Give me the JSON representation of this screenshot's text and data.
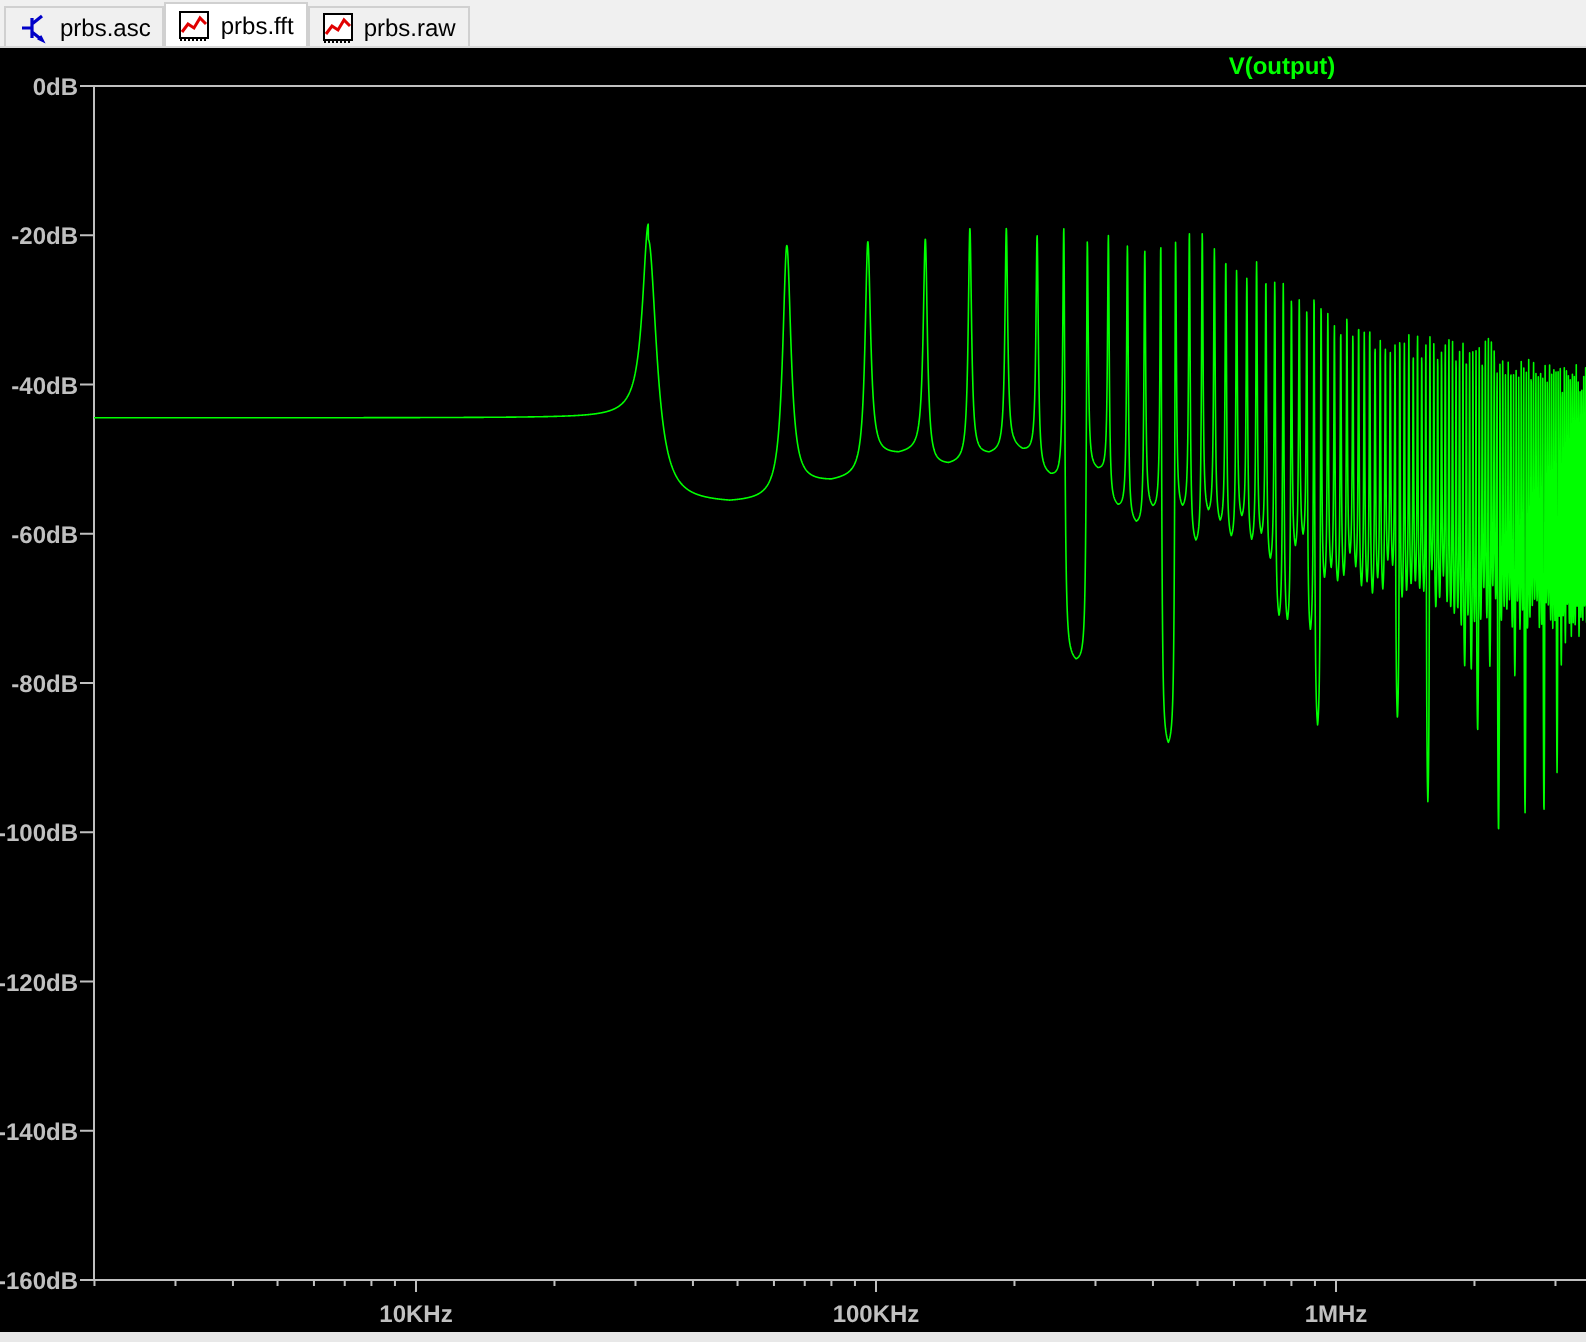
{
  "tabs": [
    {
      "label": "prbs.asc",
      "kind": "schematic",
      "selected": false
    },
    {
      "label": "prbs.fft",
      "kind": "waveform",
      "selected": true
    },
    {
      "label": "prbs.raw",
      "kind": "waveform",
      "selected": false
    }
  ],
  "plot": {
    "trace_label": "V(output)",
    "y_ticks": [
      "0dB",
      "-20dB",
      "-40dB",
      "-60dB",
      "-80dB",
      "-100dB",
      "-120dB",
      "-140dB",
      "-160dB"
    ],
    "x_ticks": [
      "10KHz",
      "100KHz",
      "1MHz"
    ]
  }
}
